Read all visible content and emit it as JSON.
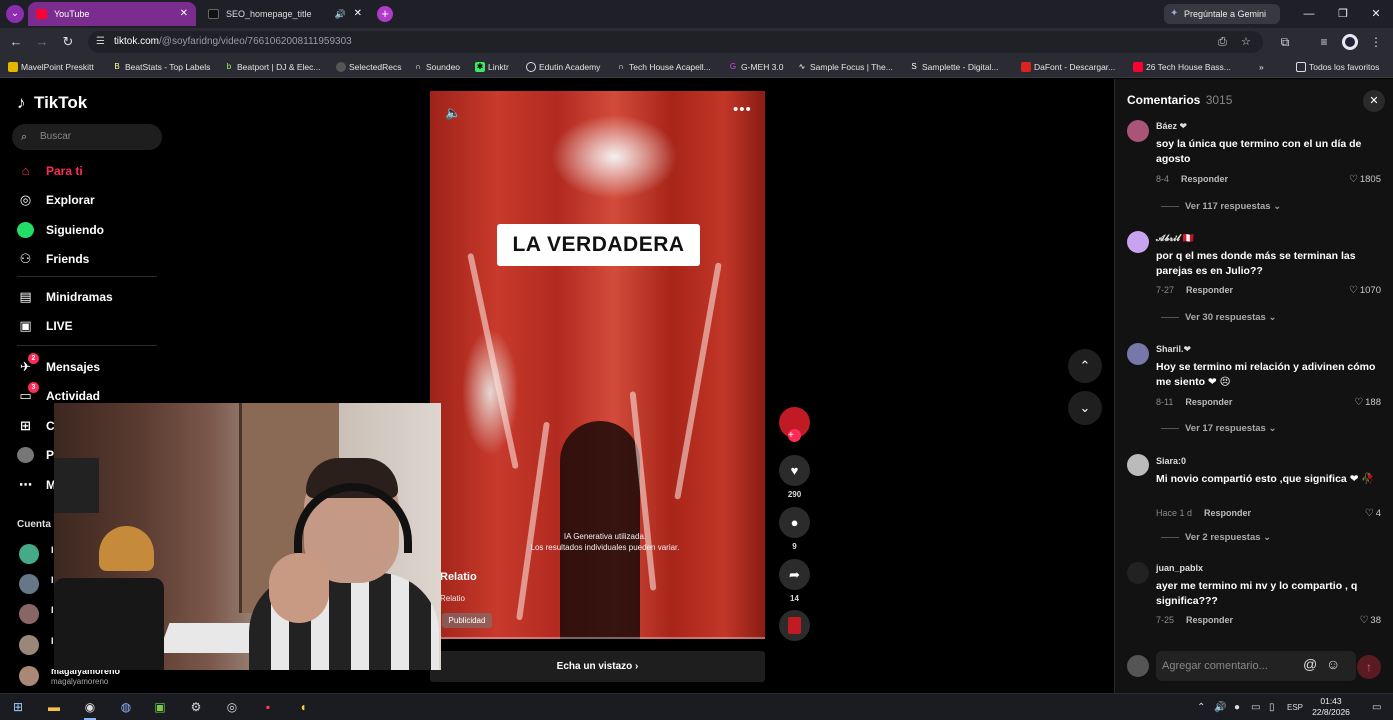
{
  "browser": {
    "tabs": [
      {
        "label": "YouTube",
        "active": true
      },
      {
        "label": "SEO_homepage_title",
        "active": false
      }
    ],
    "gemini_label": "Pregúntale a Gemini",
    "url_host": "tiktok.com",
    "url_path": "/@soyfaridng/video/7661062008111959303",
    "bookmarks": [
      "MavelPoint Preskitt",
      "BeatStats - Top Labels",
      "Beatport | DJ & Elec...",
      "SelectedRecs",
      "Soundeo",
      "Linktr",
      "Edutin Academy",
      "Tech House Acapell...",
      "G-MEH 3.0",
      "Sample Focus | The...",
      "Samplette - Digital...",
      "DaFont - Descargar...",
      "26 Tech House Bass..."
    ],
    "all_bookmarks": "Todos los favoritos"
  },
  "sidebar": {
    "logo": "TikTok",
    "search_placeholder": "Buscar",
    "nav": [
      {
        "label": "Para ti",
        "icon": "home-icon",
        "active": true
      },
      {
        "label": "Explorar",
        "icon": "compass-icon"
      },
      {
        "label": "Siguiendo",
        "icon": "following-icon"
      },
      {
        "label": "Friends",
        "icon": "friends-icon"
      },
      {
        "label": "Minidramas",
        "icon": "minidramas-icon"
      },
      {
        "label": "LIVE",
        "icon": "live-icon"
      },
      {
        "label": "Mensajes",
        "icon": "messages-icon",
        "badge": "2"
      },
      {
        "label": "Actividad",
        "icon": "activity-icon",
        "badge": "3"
      },
      {
        "label": "C",
        "icon": "create-icon"
      },
      {
        "label": "P",
        "icon": "profile-icon"
      },
      {
        "label": "M",
        "icon": "more-icon"
      }
    ],
    "accounts_title": "Cuenta",
    "accounts": [
      {
        "name": "I",
        "sub": ""
      },
      {
        "name": "I",
        "sub": ""
      },
      {
        "name": "I",
        "sub": ""
      },
      {
        "name": "I",
        "sub": ""
      },
      {
        "name": "magalyamoreno",
        "sub": "magalyamoreno"
      }
    ]
  },
  "video": {
    "caption": "LA VERDADERA",
    "ai_line1": "IA Generativa utilizada.",
    "ai_line2": "Los resultados individuales pueden variar.",
    "title": "Relatio",
    "subtitle": "Relatio",
    "ad_tag": "Publicidad",
    "cta": "Echa un vistazo",
    "likes": "290",
    "comments": "9",
    "shares": "14"
  },
  "comments": {
    "title": "Comentarios",
    "count": "3015",
    "reply_label": "Responder",
    "items": [
      {
        "user": "Báez ❤",
        "text": "soy la única que termino con el un día de agosto",
        "date": "8-4",
        "likes": "1805",
        "more": "Ver 117 respuestas"
      },
      {
        "user": "𝓐𝓫𝓻𝓲𝓵 🇵🇪",
        "text": "por q el mes donde más se terminan las parejas es en Julio??",
        "date": "7-27",
        "likes": "1070",
        "more": "Ver 30 respuestas"
      },
      {
        "user": "Sharil.❤",
        "text": "Hoy se termino mi relación y adivinen cómo me siento ❤ 😣",
        "date": "8-11",
        "likes": "188",
        "more": "Ver 17 respuestas"
      },
      {
        "user": "Siara:0",
        "text": "Mi novio compartió esto ,que significa ❤ 🥀",
        "date": "Hace 1 d",
        "likes": "4",
        "more": "Ver 2 respuestas"
      },
      {
        "user": "juan_pablx",
        "text": "ayer me termino mi nv y lo compartio , q significa???",
        "date": "7-25",
        "likes": "38",
        "more": ""
      }
    ],
    "input_placeholder": "Agregar comentario..."
  },
  "taskbar": {
    "lang": "ESP",
    "time": "01:43",
    "date": "22/8/2026"
  },
  "colors": {
    "accent": "#fe2c55",
    "tab_active": "#7b2c8f"
  }
}
